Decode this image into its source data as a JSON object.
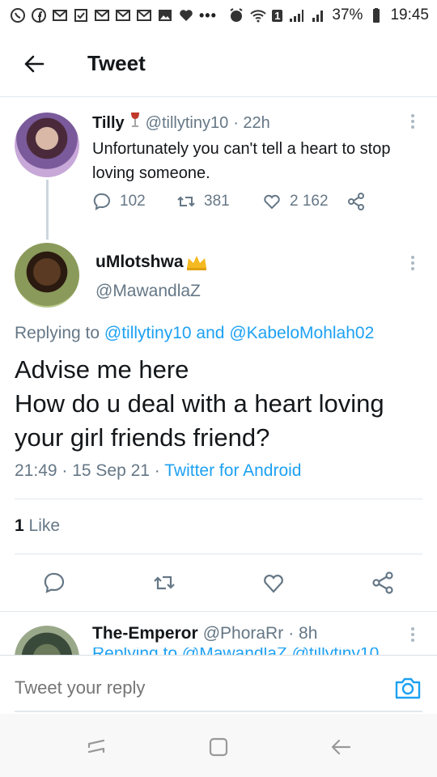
{
  "status_bar": {
    "battery": "37%",
    "time": "19:45",
    "sim_badge": "1",
    "left_icons": [
      "whatsapp-icon",
      "facebook-icon",
      "gmail-icon",
      "checkbox-icon",
      "gmail-icon",
      "gmail-icon",
      "gmail-icon",
      "image-icon",
      "heart-icon"
    ],
    "more_dots": "•••"
  },
  "header": {
    "title": "Tweet"
  },
  "parent_tweet": {
    "name": "Tilly",
    "handle": "@tillytiny10",
    "time": "· 22h",
    "text": "Unfortunately you can't tell a heart to stop loving someone.",
    "replies": "102",
    "retweets": "381",
    "likes": "2 162"
  },
  "main_tweet": {
    "name": "uMlotshwa",
    "handle": "@MawandlaZ",
    "replying_prefix": "Replying to ",
    "replying_user1": "@tillytiny10",
    "replying_and": " and ",
    "replying_user2": "@KabeloMohlah02",
    "text_line1": "Advise me here",
    "text_line2": "How do u deal with a heart loving your girl friends friend?",
    "time": "21:49 · 15 Sep 21 · ",
    "source": "Twitter for Android",
    "like_count": "1",
    "like_label": " Like"
  },
  "reply_preview": {
    "name": "The-Emperor",
    "handle": "@PhoraRr",
    "time": "· 8h",
    "text_cut": "Replying to @MawandlaZ @tillytiny10"
  },
  "composer": {
    "placeholder": "Tweet your reply"
  },
  "colors": {
    "link": "#1da1f2",
    "secondary_text": "#657786",
    "primary_text": "#14171a",
    "divider": "#e1e8ed"
  }
}
